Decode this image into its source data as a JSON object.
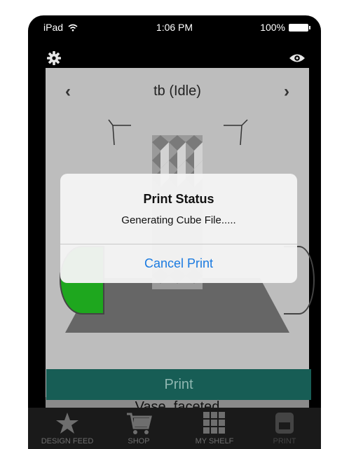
{
  "status_bar": {
    "device": "iPad",
    "time": "1:06 PM",
    "battery": "100%"
  },
  "toolbar": {
    "settings_icon": "gear-icon",
    "view_icon": "eye-icon"
  },
  "printer": {
    "name": "tb (Idle)"
  },
  "model": {
    "name": "Vase_faceted"
  },
  "actions": {
    "print_label": "Print"
  },
  "tabs": [
    {
      "label": "DESIGN FEED",
      "icon": "star-icon"
    },
    {
      "label": "SHOP",
      "icon": "cart-icon"
    },
    {
      "label": "MY SHELF",
      "icon": "grid-icon"
    },
    {
      "label": "PRINT",
      "icon": "printer-icon"
    }
  ],
  "dialog": {
    "title": "Print Status",
    "message": "Generating Cube File.....",
    "cancel_label": "Cancel Print"
  },
  "colors": {
    "accent_green": "#1ea71e",
    "print_button": "#175d55",
    "dialog_link": "#1a7ae0"
  }
}
